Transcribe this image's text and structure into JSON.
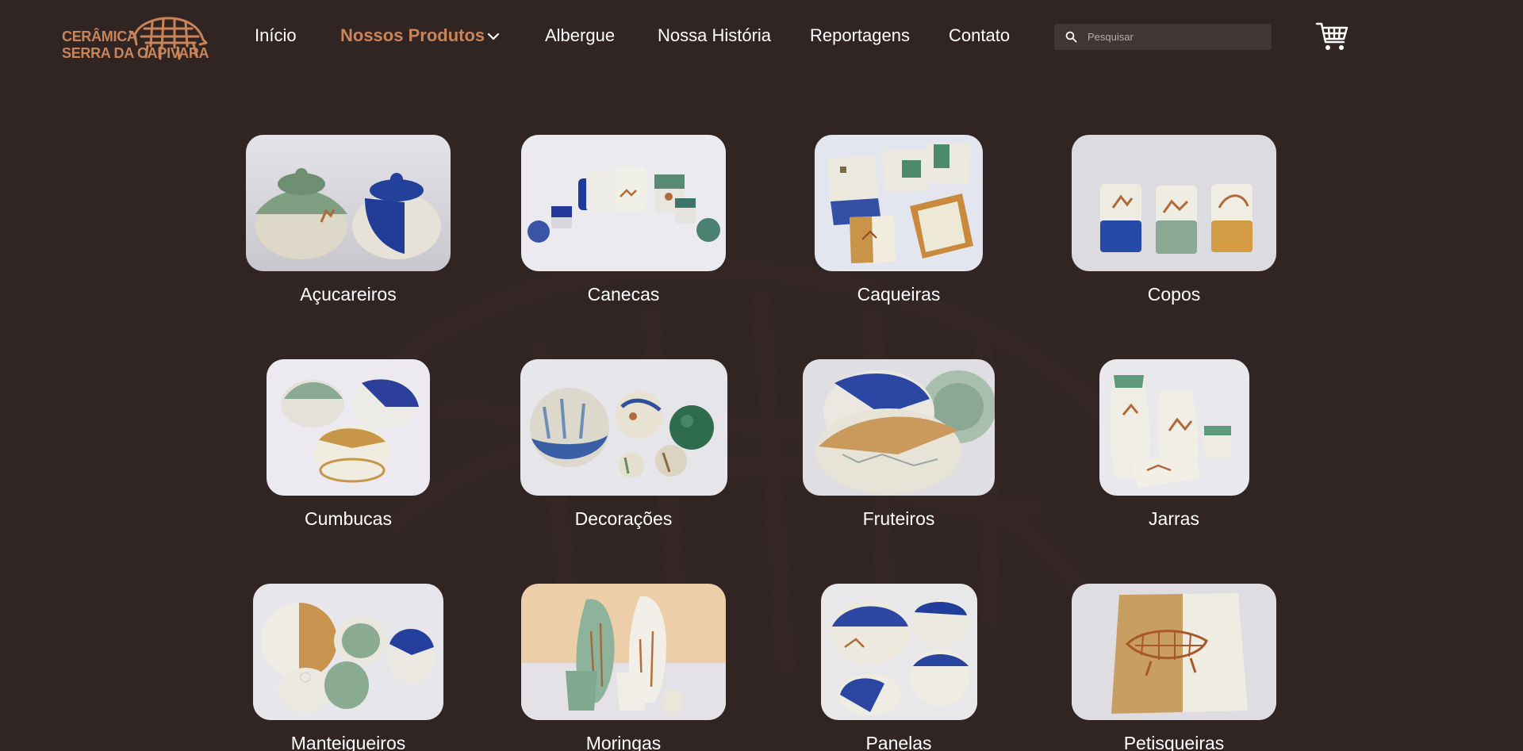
{
  "brand": {
    "line1": "CERÂMICA",
    "line2": "SERRA DA CAPIVARA",
    "color": "#c9845a"
  },
  "nav": {
    "items": [
      {
        "label": "Início"
      },
      {
        "label": "Nossos Produtos"
      },
      {
        "label": "Albergue"
      },
      {
        "label": "Nossa História"
      },
      {
        "label": "Reportagens"
      },
      {
        "label": "Contato"
      }
    ],
    "active": "Nossos Produtos",
    "dropdown_icon": "chevron-down-icon"
  },
  "search": {
    "placeholder": "Pesquisar",
    "icon": "search-icon"
  },
  "cart": {
    "icon": "shopping-cart-icon"
  },
  "colors": {
    "background": "#312524",
    "accent": "#c9845a",
    "search_bg": "#423634"
  },
  "products": [
    {
      "label": "Açucareiros"
    },
    {
      "label": "Canecas"
    },
    {
      "label": "Caqueiras"
    },
    {
      "label": "Copos"
    },
    {
      "label": "Cumbucas"
    },
    {
      "label": "Decorações"
    },
    {
      "label": "Fruteiros"
    },
    {
      "label": "Jarras"
    },
    {
      "label": "Manteigueiros"
    },
    {
      "label": "Moringas"
    },
    {
      "label": "Panelas"
    },
    {
      "label": "Petisqueiras"
    }
  ]
}
